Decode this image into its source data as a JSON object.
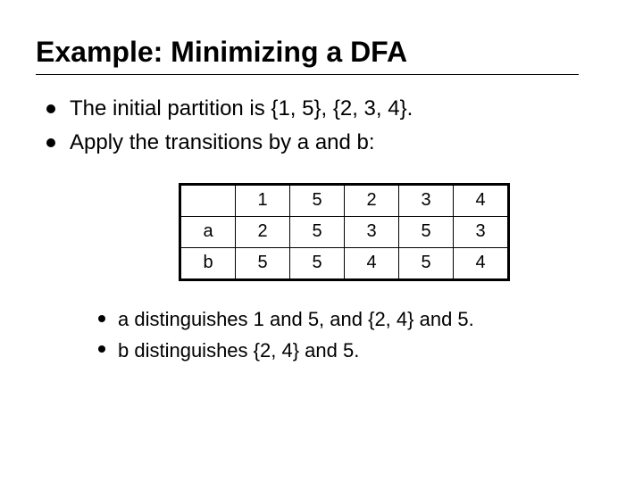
{
  "title": "Example: Minimizing a DFA",
  "bullets": {
    "top": [
      "The initial partition is {1, 5}, {2, 3, 4}.",
      "Apply the transitions by a and b:"
    ],
    "sub": [
      "a distinguishes 1 and 5, and {2, 4} and 5.",
      "b distinguishes {2, 4} and 5."
    ]
  },
  "table": {
    "col_headers": [
      "1",
      "5",
      "2",
      "3",
      "4"
    ],
    "rows": [
      {
        "label": "a",
        "cells": [
          "2",
          "5",
          "3",
          "5",
          "3"
        ]
      },
      {
        "label": "b",
        "cells": [
          "5",
          "5",
          "4",
          "5",
          "4"
        ]
      }
    ]
  }
}
